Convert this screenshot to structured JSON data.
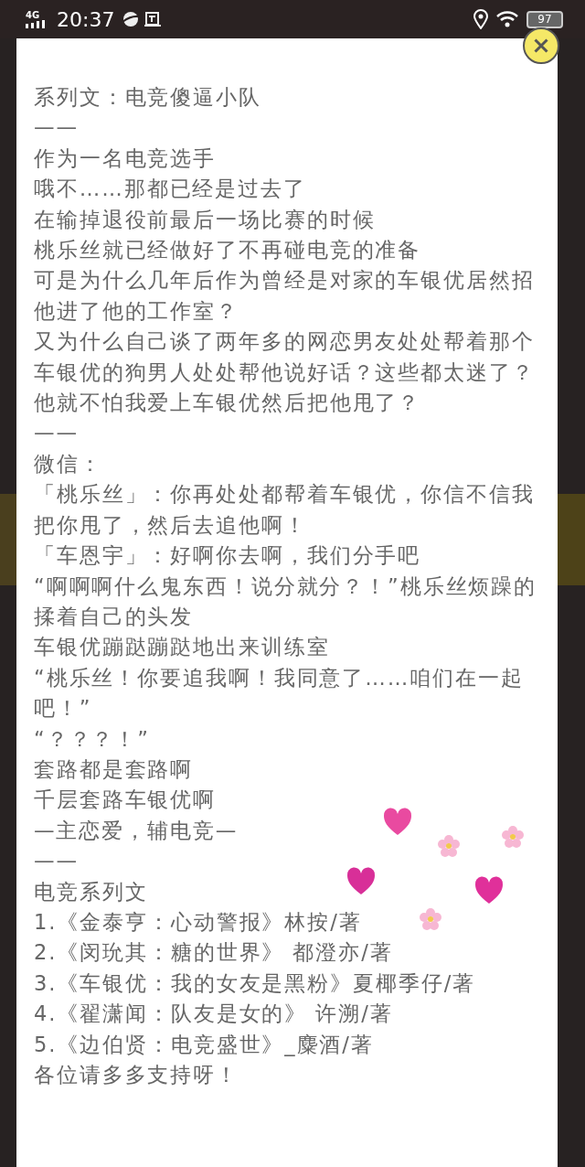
{
  "status_bar": {
    "network": "4G",
    "time": "20:37",
    "battery": "97"
  },
  "popup": {
    "lines": [
      "系列文：电竞傻逼小队",
      "——",
      "作为一名电竞选手",
      "哦不……那都已经是过去了",
      "在输掉退役前最后一场比赛的时候",
      "桃乐丝就已经做好了不再碰电竞的准备",
      "可是为什么几年后作为曾经是对家的车银优居然招他进了他的工作室？",
      "又为什么自己谈了两年多的网恋男友处处帮着那个车银优的狗男人处处帮他说好话？这些都太迷了？他就不怕我爱上车银优然后把他甩了？",
      "——",
      "微信：",
      "「桃乐丝」：你再处处都帮着车银优，你信不信我把你甩了，然后去追他啊！",
      "「车恩宇」：好啊你去啊，我们分手吧",
      "“啊啊啊什么鬼东西！说分就分？！”桃乐丝烦躁的揉着自己的头发",
      "车银优蹦跶蹦跶地出来训练室",
      "“桃乐丝！你要追我啊！我同意了……咱们在一起吧！”",
      "“？？？！”",
      "套路都是套路啊",
      "千层套路车银优啊",
      "—主恋爱，辅电竞—",
      "——",
      "电竞系列文",
      "1.《金泰亨：心动警报》林按/著",
      "2.《闵玧其：糖的世界》 都澄亦/著",
      "3.《车银优：我的女友是黑粉》夏椰季仔/著",
      "4.《翟潇闻：队友是女的》 许溯/著",
      "5.《边伯贤：电竞盛世》_麋酒/著",
      "各位请多多支持呀！"
    ]
  }
}
